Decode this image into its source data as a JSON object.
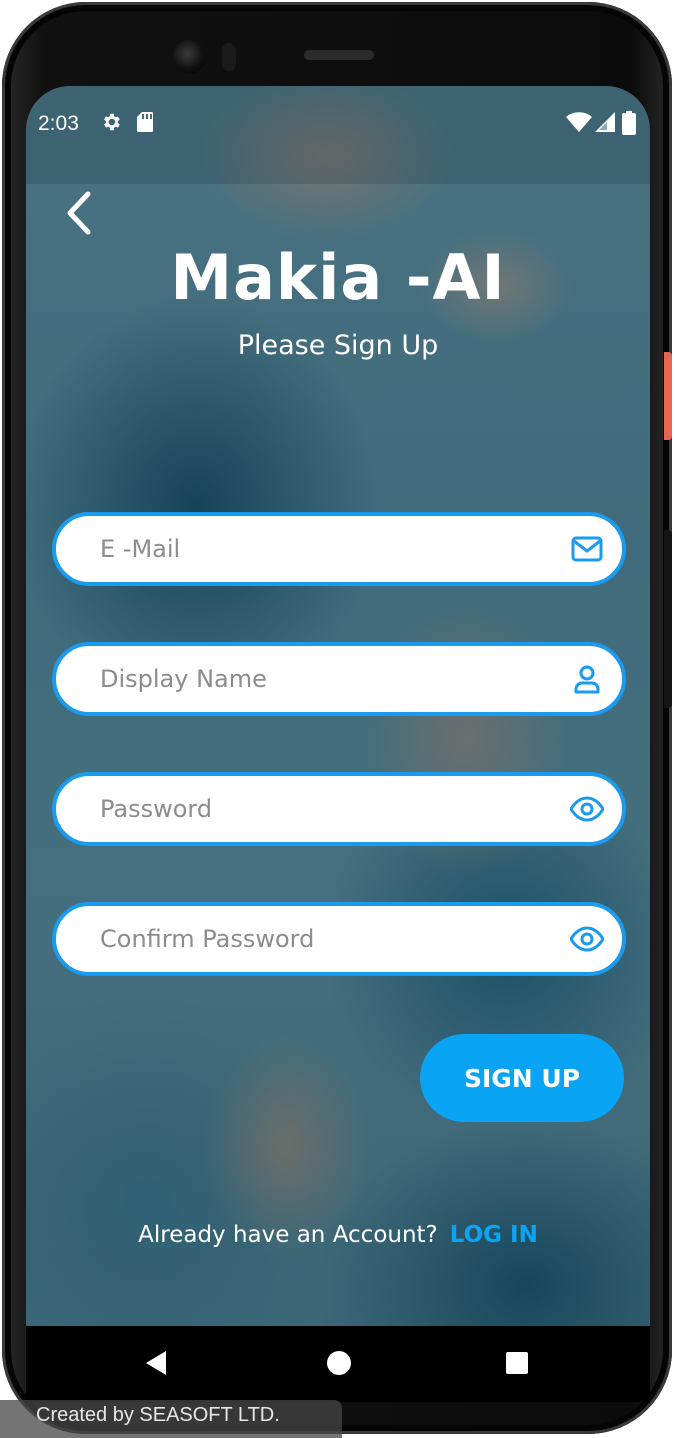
{
  "status_bar": {
    "time": "2:03",
    "icons": [
      "settings-gear-icon",
      "sd-card-icon",
      "wifi-icon",
      "cell-signal-icon",
      "battery-icon"
    ]
  },
  "header": {
    "back_icon": "chevron-left-icon",
    "app_title": "Makia -AI",
    "subtitle": "Please Sign Up"
  },
  "form": {
    "email": {
      "placeholder": "E -Mail",
      "value": "",
      "icon": "mail-icon"
    },
    "display_name": {
      "placeholder": "Display Name",
      "value": "",
      "icon": "user-icon"
    },
    "password": {
      "placeholder": "Password",
      "value": "",
      "icon": "eye-icon"
    },
    "confirm_password": {
      "placeholder": "Confirm Password",
      "value": "",
      "icon": "eye-icon"
    },
    "submit_label": "SIGN UP"
  },
  "footer": {
    "question": "Already have an Account?",
    "login_link": "LOG IN"
  },
  "nav_bar": {
    "buttons": [
      "back-triangle-icon",
      "home-circle-icon",
      "recents-square-icon"
    ]
  },
  "credit": "Created by SEASOFT LTD.",
  "colors": {
    "accent": "#0aa4f4",
    "field_border": "#1a9bf0",
    "background_teal": "#3f6b7c"
  }
}
